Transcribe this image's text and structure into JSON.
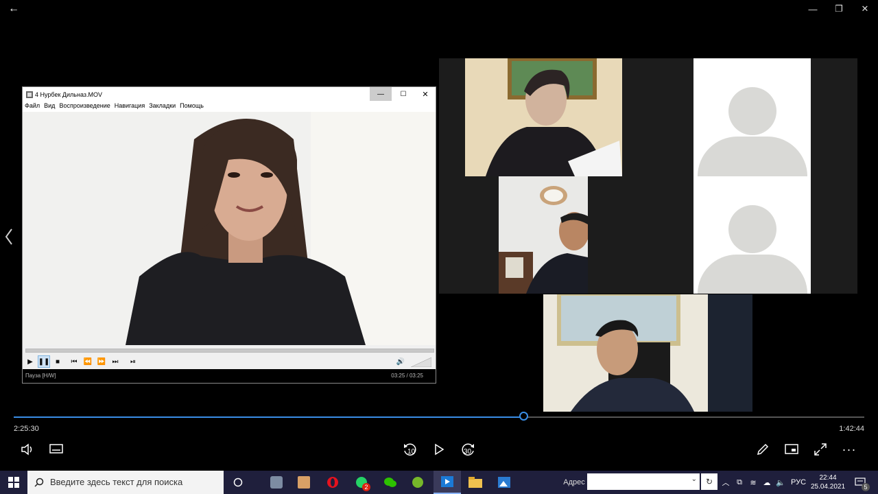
{
  "window": {
    "back": "←",
    "minimize": "—",
    "restore": "❐",
    "close": "✕"
  },
  "player_window": {
    "title": "4 Нурбек Дильназ.MOV",
    "menu": [
      "Файл",
      "Вид",
      "Воспроизведение",
      "Навигация",
      "Закладки",
      "Помощь"
    ],
    "status_left": "Пауза [H/W]",
    "status_right": "03:25 / 03:25",
    "progress": 1.0
  },
  "playback": {
    "elapsed": "2:25:30",
    "remaining": "1:42:44",
    "progress": 0.6
  },
  "controls": {
    "skip_back": "10",
    "skip_forward": "30"
  },
  "taskbar": {
    "search_placeholder": "Введите здесь текст для поиска",
    "address_label": "Адрес",
    "lang": "РУС",
    "time": "22:44",
    "date": "25.04.2021",
    "notification_count": "5",
    "whatsapp_badge": "2"
  },
  "colors": {
    "accent": "#3a8ee6",
    "taskbar": "#1f1f3c"
  }
}
